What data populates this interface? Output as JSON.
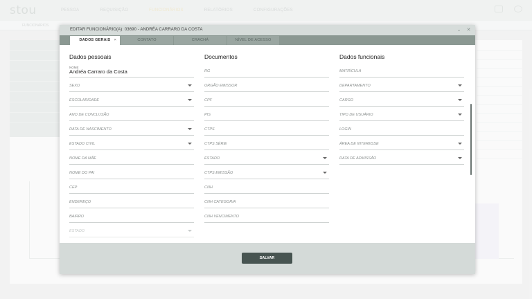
{
  "app": {
    "logo": "stou",
    "nav": [
      "PESSOA",
      "REQUISIÇÃO",
      "FUNCIONÁRIOS",
      "RELATÓRIOS",
      "CONFIGURAÇÕES"
    ],
    "breadcrumb": "FUNCIONÁRIOS"
  },
  "modal": {
    "title": "EDITAR FUNCIONÁRIO(A): 03690 - ANDRÉA CARRARO DA COSTA",
    "tabs": [
      {
        "label": "DADOS GERAIS",
        "close": "×"
      },
      {
        "label": "CONTATO"
      },
      {
        "label": "CRACHÁ"
      },
      {
        "label": "NÍVEL DE ACESSO"
      }
    ],
    "header_icons": {
      "minimize": "chevron-down-icon",
      "close": "close-icon"
    },
    "columns": {
      "personal": {
        "heading": "Dados pessoais",
        "name_label": "NOME",
        "name_value": "Andréa Carraro da Costa",
        "fields": [
          "SEXO",
          "ESCOLARIDADE",
          "ANO DE CONCLUSÃO",
          "DATA DE NASCIMENTO",
          "ESTADO CIVIL",
          "NOME DA MÃE",
          "NOME DO PAI",
          "CEP",
          "ENDEREÇO",
          "BAIRRO",
          "ESTADO"
        ]
      },
      "documents": {
        "heading": "Documentos",
        "fields": [
          "RG",
          "ORGÃO EMISSOR",
          "CPF",
          "PIS",
          "CTPS",
          "CTPS SÉRIE",
          "ESTADO",
          "CTPS EMISSÃO",
          "CNH",
          "CNH CATEGORIA",
          "CNH VENCIMENTO"
        ]
      },
      "functional": {
        "heading": "Dados funcionais",
        "fields": [
          "MATRÍCULA",
          "DEPARTAMENTO",
          "CARGO",
          "TIPO DE USUÁRIO",
          "LOGIN",
          "ÁREA DE INTERESSE",
          "DATA DE ADMISSÃO"
        ]
      }
    },
    "save_label": "SALVAR"
  }
}
